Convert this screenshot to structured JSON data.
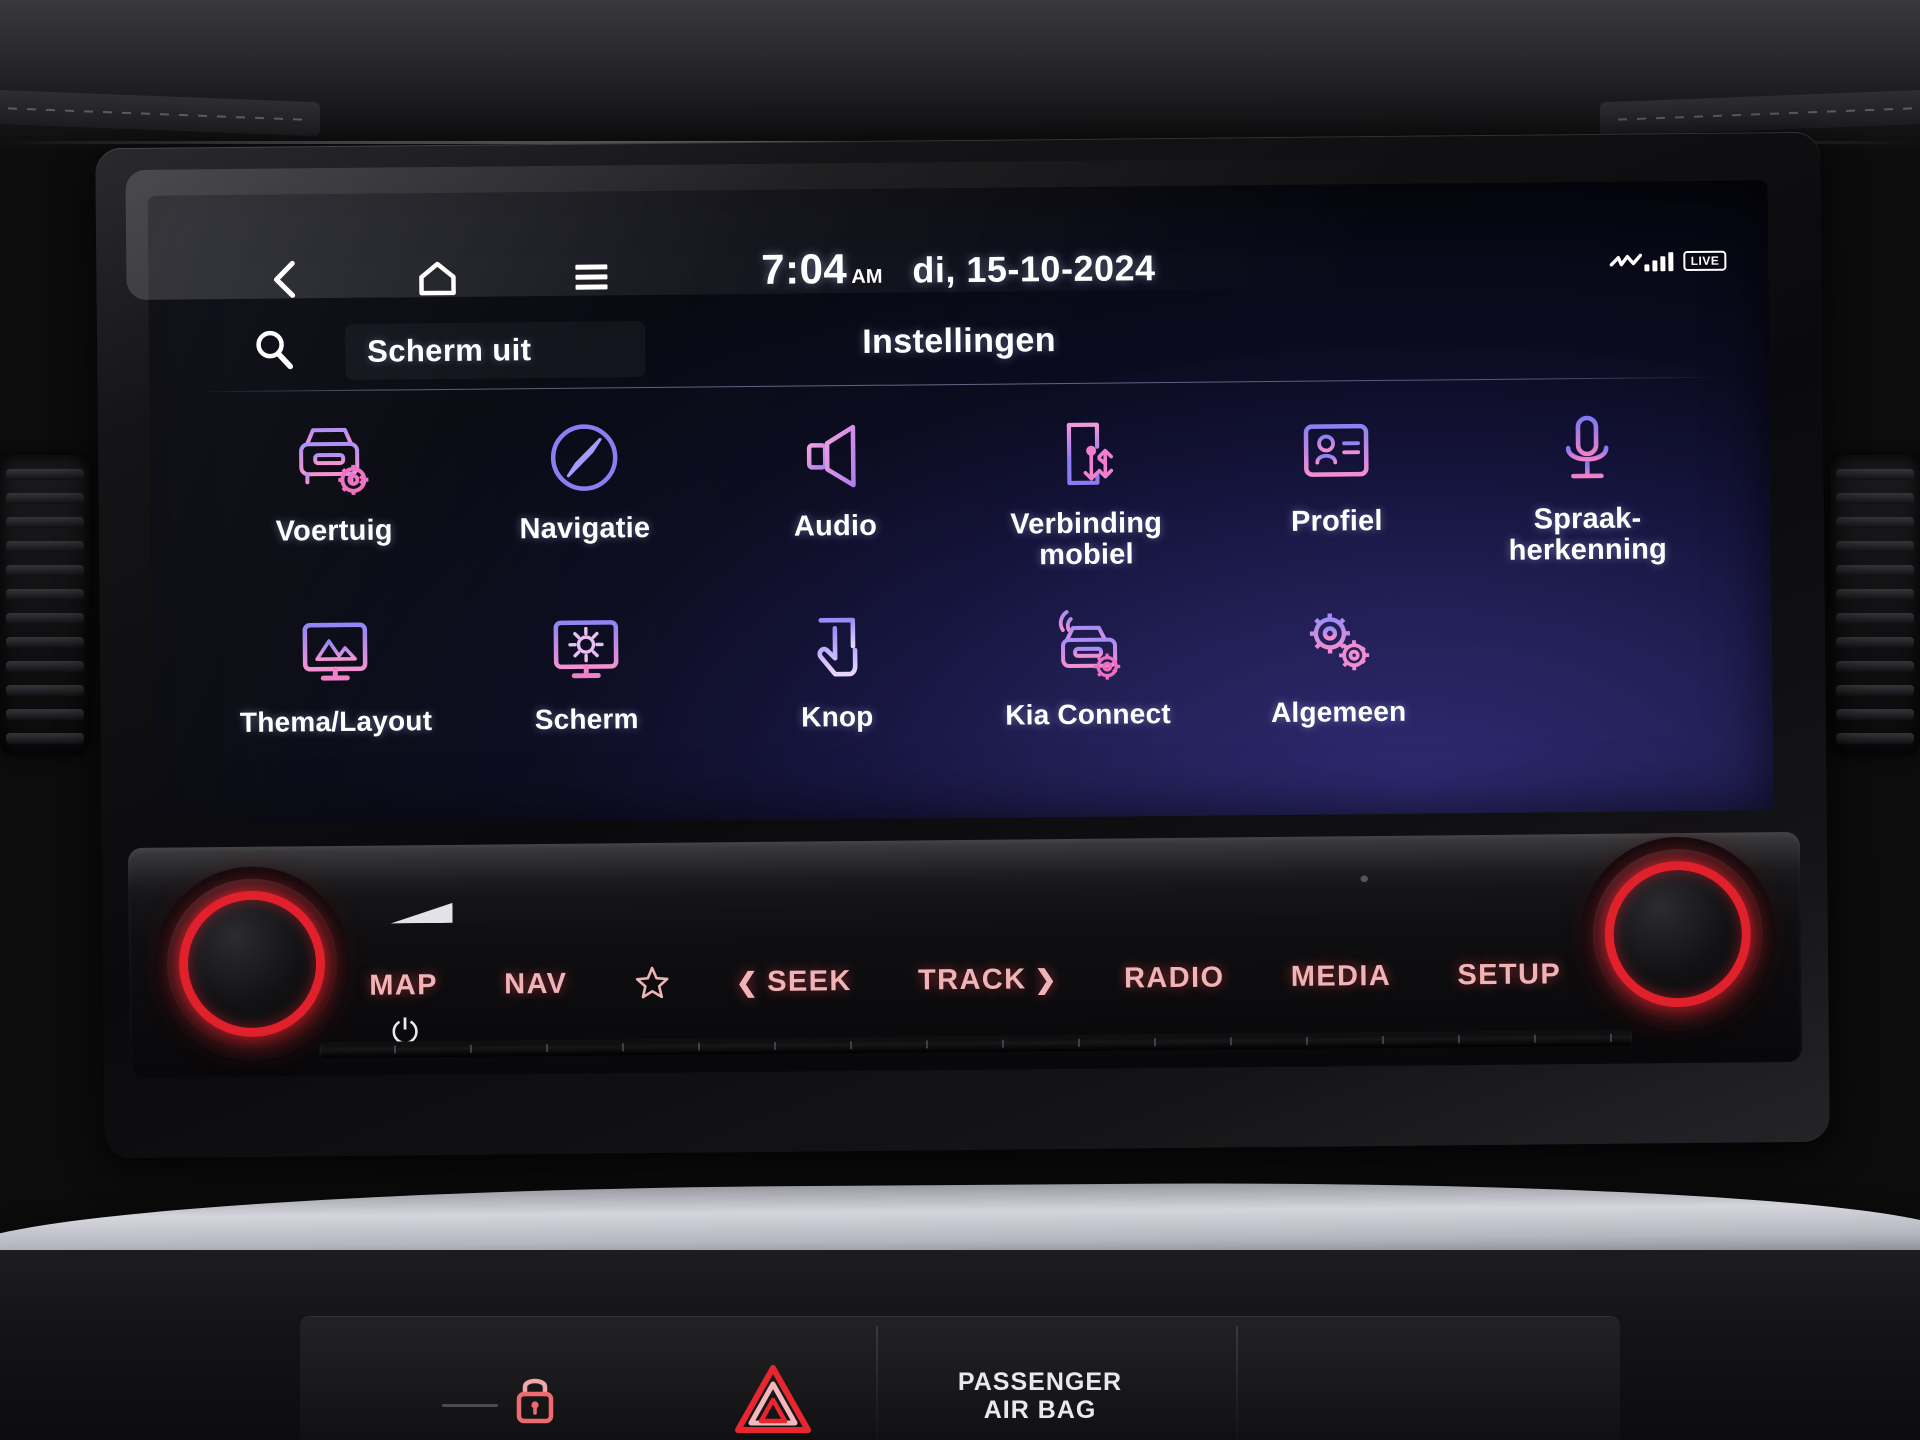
{
  "statusbar": {
    "back_icon": "chevron-left-icon",
    "home_icon": "home-icon",
    "menu_icon": "hamburger-menu-icon",
    "time": "7:04",
    "ampm": "AM",
    "date": "di, 15-10-2024",
    "brand_icon": "kia-logo-icon",
    "signal_icon": "signal-bars-icon",
    "live_badge": "LIVE"
  },
  "searchbar": {
    "search_icon": "search-icon",
    "screen_off_label": "Scherm uit",
    "page_title": "Instellingen"
  },
  "menu": {
    "row1": [
      {
        "label": "Voertuig",
        "icon": "car-settings-icon"
      },
      {
        "label": "Navigatie",
        "icon": "compass-icon"
      },
      {
        "label": "Audio",
        "icon": "speaker-icon"
      },
      {
        "label": "Verbinding\nmobiel",
        "icon": "phone-connectivity-icon"
      },
      {
        "label": "Profiel",
        "icon": "id-card-icon"
      },
      {
        "label": "Spraak-\nherkenning",
        "icon": "microphone-icon"
      }
    ],
    "row2": [
      {
        "label": "Thema/Layout",
        "icon": "monitor-image-icon"
      },
      {
        "label": "Scherm",
        "icon": "monitor-brightness-icon"
      },
      {
        "label": "Knop",
        "icon": "hand-touch-icon"
      },
      {
        "label": "Kia Connect",
        "icon": "connected-car-icon"
      },
      {
        "label": "Algemeen",
        "icon": "gears-icon"
      }
    ]
  },
  "hardware_buttons": [
    {
      "label": "MAP",
      "icon": ""
    },
    {
      "label": "NAV",
      "icon": ""
    },
    {
      "label": "",
      "icon": "star-icon"
    },
    {
      "label": "SEEK",
      "icon": "chevron-left-icon"
    },
    {
      "label": "TRACK",
      "icon": "chevron-right-icon"
    },
    {
      "label": "RADIO",
      "icon": ""
    },
    {
      "label": "MEDIA",
      "icon": ""
    },
    {
      "label": "SETUP",
      "icon": ""
    }
  ],
  "knobs": {
    "left_icon": "power-volume-knob",
    "right_icon": "tune-knob",
    "power_symbol": "⏻",
    "volume_wedge": "volume-wedge-icon"
  },
  "lower_dash": {
    "lock_icon": "door-lock-icon",
    "hazard_icon": "hazard-triangle-icon",
    "airbag_line1": "PASSENGER",
    "airbag_line2": "AIR BAG"
  },
  "colors": {
    "accent_pink": "#ef8ec8",
    "accent_blue": "#7a6ff0",
    "knob_red": "#e0202a",
    "button_red": "#f0b4b6",
    "text_white": "#ffffff",
    "screen_bg_deep": "#06060f",
    "screen_bg_violet": "#2e2a72"
  }
}
